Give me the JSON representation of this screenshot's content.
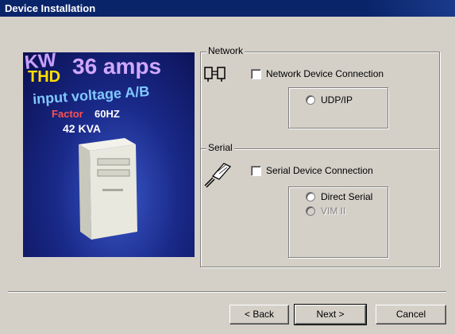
{
  "window": {
    "title": "Device Installation"
  },
  "image": {
    "overlay_texts": [
      "KW",
      "36 amps",
      "THD",
      "input voltage A/B",
      "Factor",
      "60HZ",
      "42 KVA"
    ]
  },
  "network": {
    "legend": "Network",
    "checkbox_label": "Network Device Connection",
    "checked": false,
    "options": [
      {
        "label": "UDP/IP",
        "enabled": true
      }
    ]
  },
  "serial": {
    "legend": "Serial",
    "checkbox_label": "Serial Device Connection",
    "checked": false,
    "options": [
      {
        "label": "Direct Serial",
        "enabled": true
      },
      {
        "label": "VIM II",
        "enabled": false
      }
    ]
  },
  "buttons": {
    "back": "< Back",
    "next": "Next >",
    "cancel": "Cancel"
  },
  "colors": {
    "title_bar": "#0a246a",
    "dialog_bg": "#d4d0c8"
  }
}
